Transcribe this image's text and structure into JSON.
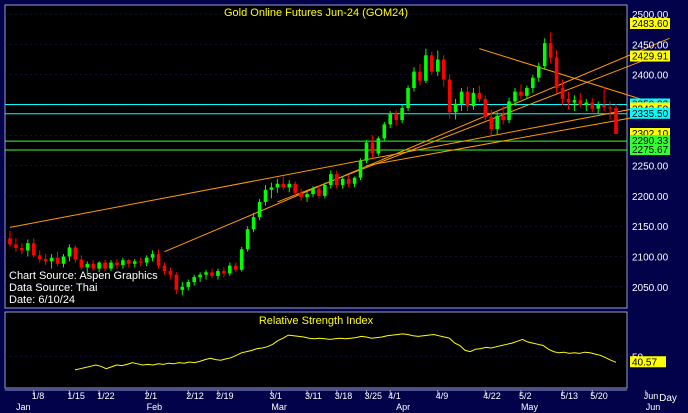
{
  "chart_data": [
    {
      "type": "candlestick",
      "title": "Gold Online Futures Jun-24 (GOM24)",
      "annotations": [
        "Chart Source: Aspen Graphics",
        "Data Source: Thai",
        "Date: 6/10/24"
      ],
      "ylim": [
        2020,
        2510
      ],
      "y_ticks": [
        2050,
        2100,
        2150,
        2200,
        2250,
        2300,
        2350,
        2400,
        2450,
        2500
      ],
      "y_tick_labels": [
        "2050.00",
        "2100.00",
        "2150.00",
        "2200.00",
        "2250.00",
        "2300.00",
        "2350.00",
        "2400.00",
        "2450.00",
        "2500.00"
      ],
      "price_labels": [
        {
          "value": 2483.6,
          "text": "2483.60",
          "color": "#ffff00"
        },
        {
          "value": 2429.91,
          "text": "2429.91",
          "color": "#ffff00"
        },
        {
          "value": 2350.83,
          "text": "2350.83",
          "color": "#00ffff"
        },
        {
          "value": 2344.32,
          "text": "2344.32",
          "color": "#ffff00"
        },
        {
          "value": 2342.5,
          "text": "2342.50",
          "color": "#ffff00"
        },
        {
          "value": 2335.5,
          "text": "2335.50",
          "color": "#00ffff"
        },
        {
          "value": 2302.1,
          "text": "2302.10",
          "color": "#ffff00"
        },
        {
          "value": 2290.33,
          "text": "2290.33",
          "color": "#33ff33"
        },
        {
          "value": 2275.67,
          "text": "2275.67",
          "color": "#33ff33"
        }
      ],
      "horizontal_lines": [
        {
          "value": 2350.83,
          "color": "#00ffff"
        },
        {
          "value": 2335.5,
          "color": "#00ffff"
        },
        {
          "value": 2290.33,
          "color": "#33ff33"
        },
        {
          "value": 2275.67,
          "color": "#33ff33"
        }
      ],
      "trend_lines": [
        {
          "from": [
            0,
            2148
          ],
          "to": [
            111,
            2355
          ],
          "color": "#ff9900"
        },
        {
          "from": [
            26,
            2108
          ],
          "to": [
            111,
            2460
          ],
          "color": "#ff9900"
        },
        {
          "from": [
            45,
            2190
          ],
          "to": [
            111,
            2440
          ],
          "color": "#ff9900"
        },
        {
          "from": [
            79,
            2443
          ],
          "to": [
            111,
            2345
          ],
          "color": "#ff9900"
        },
        {
          "from": [
            60,
            2250
          ],
          "to": [
            111,
            2340
          ],
          "color": "#ff9900"
        }
      ],
      "candles": [
        {
          "o": 2130,
          "h": 2142,
          "l": 2116,
          "c": 2120
        },
        {
          "o": 2120,
          "h": 2130,
          "l": 2108,
          "c": 2114
        },
        {
          "o": 2114,
          "h": 2122,
          "l": 2104,
          "c": 2110
        },
        {
          "o": 2110,
          "h": 2128,
          "l": 2100,
          "c": 2122
        },
        {
          "o": 2122,
          "h": 2130,
          "l": 2098,
          "c": 2102
        },
        {
          "o": 2102,
          "h": 2110,
          "l": 2090,
          "c": 2096
        },
        {
          "o": 2096,
          "h": 2104,
          "l": 2086,
          "c": 2092
        },
        {
          "o": 2092,
          "h": 2104,
          "l": 2080,
          "c": 2098
        },
        {
          "o": 2098,
          "h": 2108,
          "l": 2084,
          "c": 2088
        },
        {
          "o": 2088,
          "h": 2104,
          "l": 2082,
          "c": 2100
        },
        {
          "o": 2100,
          "h": 2120,
          "l": 2092,
          "c": 2115
        },
        {
          "o": 2115,
          "h": 2118,
          "l": 2090,
          "c": 2095
        },
        {
          "o": 2095,
          "h": 2102,
          "l": 2078,
          "c": 2082
        },
        {
          "o": 2082,
          "h": 2092,
          "l": 2072,
          "c": 2088
        },
        {
          "o": 2088,
          "h": 2094,
          "l": 2076,
          "c": 2080
        },
        {
          "o": 2080,
          "h": 2092,
          "l": 2074,
          "c": 2090
        },
        {
          "o": 2090,
          "h": 2095,
          "l": 2076,
          "c": 2080
        },
        {
          "o": 2080,
          "h": 2094,
          "l": 2076,
          "c": 2090
        },
        {
          "o": 2090,
          "h": 2096,
          "l": 2080,
          "c": 2086
        },
        {
          "o": 2086,
          "h": 2098,
          "l": 2080,
          "c": 2094
        },
        {
          "o": 2094,
          "h": 2096,
          "l": 2082,
          "c": 2088
        },
        {
          "o": 2088,
          "h": 2096,
          "l": 2082,
          "c": 2092
        },
        {
          "o": 2092,
          "h": 2098,
          "l": 2084,
          "c": 2090
        },
        {
          "o": 2090,
          "h": 2102,
          "l": 2084,
          "c": 2098
        },
        {
          "o": 2098,
          "h": 2110,
          "l": 2092,
          "c": 2104
        },
        {
          "o": 2104,
          "h": 2112,
          "l": 2080,
          "c": 2085
        },
        {
          "o": 2085,
          "h": 2090,
          "l": 2070,
          "c": 2076
        },
        {
          "o": 2076,
          "h": 2082,
          "l": 2062,
          "c": 2070
        },
        {
          "o": 2070,
          "h": 2074,
          "l": 2038,
          "c": 2045
        },
        {
          "o": 2045,
          "h": 2058,
          "l": 2036,
          "c": 2050
        },
        {
          "o": 2050,
          "h": 2062,
          "l": 2044,
          "c": 2058
        },
        {
          "o": 2058,
          "h": 2070,
          "l": 2052,
          "c": 2066
        },
        {
          "o": 2066,
          "h": 2074,
          "l": 2058,
          "c": 2070
        },
        {
          "o": 2070,
          "h": 2078,
          "l": 2062,
          "c": 2074
        },
        {
          "o": 2074,
          "h": 2080,
          "l": 2064,
          "c": 2068
        },
        {
          "o": 2068,
          "h": 2080,
          "l": 2062,
          "c": 2076
        },
        {
          "o": 2076,
          "h": 2082,
          "l": 2066,
          "c": 2072
        },
        {
          "o": 2072,
          "h": 2090,
          "l": 2068,
          "c": 2085
        },
        {
          "o": 2085,
          "h": 2090,
          "l": 2074,
          "c": 2078
        },
        {
          "o": 2078,
          "h": 2116,
          "l": 2075,
          "c": 2112
        },
        {
          "o": 2112,
          "h": 2150,
          "l": 2108,
          "c": 2145
        },
        {
          "o": 2145,
          "h": 2172,
          "l": 2140,
          "c": 2165
        },
        {
          "o": 2165,
          "h": 2195,
          "l": 2160,
          "c": 2190
        },
        {
          "o": 2190,
          "h": 2218,
          "l": 2184,
          "c": 2210
        },
        {
          "o": 2210,
          "h": 2222,
          "l": 2196,
          "c": 2214
        },
        {
          "o": 2214,
          "h": 2228,
          "l": 2205,
          "c": 2220
        },
        {
          "o": 2220,
          "h": 2232,
          "l": 2210,
          "c": 2214
        },
        {
          "o": 2214,
          "h": 2226,
          "l": 2206,
          "c": 2220
        },
        {
          "o": 2220,
          "h": 2224,
          "l": 2200,
          "c": 2205
        },
        {
          "o": 2205,
          "h": 2212,
          "l": 2192,
          "c": 2198
        },
        {
          "o": 2198,
          "h": 2208,
          "l": 2190,
          "c": 2203
        },
        {
          "o": 2203,
          "h": 2216,
          "l": 2198,
          "c": 2212
        },
        {
          "o": 2212,
          "h": 2218,
          "l": 2196,
          "c": 2200
        },
        {
          "o": 2200,
          "h": 2222,
          "l": 2196,
          "c": 2218
        },
        {
          "o": 2218,
          "h": 2242,
          "l": 2212,
          "c": 2236
        },
        {
          "o": 2236,
          "h": 2242,
          "l": 2212,
          "c": 2218
        },
        {
          "o": 2218,
          "h": 2232,
          "l": 2212,
          "c": 2228
        },
        {
          "o": 2228,
          "h": 2234,
          "l": 2214,
          "c": 2220
        },
        {
          "o": 2220,
          "h": 2232,
          "l": 2214,
          "c": 2230
        },
        {
          "o": 2230,
          "h": 2262,
          "l": 2226,
          "c": 2258
        },
        {
          "o": 2258,
          "h": 2292,
          "l": 2254,
          "c": 2288
        },
        {
          "o": 2288,
          "h": 2300,
          "l": 2262,
          "c": 2270
        },
        {
          "o": 2270,
          "h": 2298,
          "l": 2266,
          "c": 2295
        },
        {
          "o": 2295,
          "h": 2322,
          "l": 2290,
          "c": 2318
        },
        {
          "o": 2318,
          "h": 2340,
          "l": 2312,
          "c": 2335
        },
        {
          "o": 2335,
          "h": 2342,
          "l": 2316,
          "c": 2325
        },
        {
          "o": 2325,
          "h": 2350,
          "l": 2320,
          "c": 2345
        },
        {
          "o": 2345,
          "h": 2382,
          "l": 2340,
          "c": 2378
        },
        {
          "o": 2378,
          "h": 2412,
          "l": 2372,
          "c": 2405
        },
        {
          "o": 2405,
          "h": 2418,
          "l": 2382,
          "c": 2390
        },
        {
          "o": 2390,
          "h": 2443,
          "l": 2386,
          "c": 2432
        },
        {
          "o": 2432,
          "h": 2438,
          "l": 2400,
          "c": 2405
        },
        {
          "o": 2405,
          "h": 2440,
          "l": 2398,
          "c": 2425
        },
        {
          "o": 2425,
          "h": 2432,
          "l": 2380,
          "c": 2392
        },
        {
          "o": 2392,
          "h": 2400,
          "l": 2328,
          "c": 2338
        },
        {
          "o": 2338,
          "h": 2360,
          "l": 2326,
          "c": 2352
        },
        {
          "o": 2352,
          "h": 2378,
          "l": 2340,
          "c": 2372
        },
        {
          "o": 2372,
          "h": 2380,
          "l": 2340,
          "c": 2348
        },
        {
          "o": 2348,
          "h": 2378,
          "l": 2342,
          "c": 2370
        },
        {
          "o": 2370,
          "h": 2382,
          "l": 2355,
          "c": 2360
        },
        {
          "o": 2360,
          "h": 2366,
          "l": 2325,
          "c": 2330
        },
        {
          "o": 2330,
          "h": 2342,
          "l": 2300,
          "c": 2310
        },
        {
          "o": 2310,
          "h": 2338,
          "l": 2302,
          "c": 2332
        },
        {
          "o": 2332,
          "h": 2348,
          "l": 2318,
          "c": 2325
        },
        {
          "o": 2325,
          "h": 2362,
          "l": 2320,
          "c": 2356
        },
        {
          "o": 2356,
          "h": 2378,
          "l": 2348,
          "c": 2372
        },
        {
          "o": 2372,
          "h": 2384,
          "l": 2360,
          "c": 2365
        },
        {
          "o": 2365,
          "h": 2382,
          "l": 2360,
          "c": 2378
        },
        {
          "o": 2378,
          "h": 2400,
          "l": 2370,
          "c": 2395
        },
        {
          "o": 2395,
          "h": 2420,
          "l": 2388,
          "c": 2414
        },
        {
          "o": 2414,
          "h": 2460,
          "l": 2408,
          "c": 2452
        },
        {
          "o": 2452,
          "h": 2470,
          "l": 2418,
          "c": 2428
        },
        {
          "o": 2428,
          "h": 2440,
          "l": 2370,
          "c": 2378
        },
        {
          "o": 2378,
          "h": 2392,
          "l": 2350,
          "c": 2360
        },
        {
          "o": 2360,
          "h": 2372,
          "l": 2342,
          "c": 2354
        },
        {
          "o": 2354,
          "h": 2366,
          "l": 2340,
          "c": 2358
        },
        {
          "o": 2358,
          "h": 2370,
          "l": 2346,
          "c": 2350
        },
        {
          "o": 2350,
          "h": 2360,
          "l": 2340,
          "c": 2354
        },
        {
          "o": 2354,
          "h": 2362,
          "l": 2338,
          "c": 2344
        },
        {
          "o": 2344,
          "h": 2356,
          "l": 2336,
          "c": 2350
        },
        {
          "o": 2350,
          "h": 2380,
          "l": 2340,
          "c": 2346
        },
        {
          "o": 2346,
          "h": 2356,
          "l": 2326,
          "c": 2345
        },
        {
          "o": 2345,
          "h": 2352,
          "l": 2310,
          "c": 2302
        }
      ],
      "x_ticks": [
        {
          "index": 4,
          "label": "1/8"
        },
        {
          "index": 10,
          "label": "1/15"
        },
        {
          "index": 15,
          "label": "1/22"
        },
        {
          "index": 23,
          "label": "2/1"
        },
        {
          "index": 30,
          "label": "2/12"
        },
        {
          "index": 35,
          "label": "2/19"
        },
        {
          "index": 44,
          "label": "3/1"
        },
        {
          "index": 50,
          "label": "3/11"
        },
        {
          "index": 55,
          "label": "3/18"
        },
        {
          "index": 60,
          "label": "3/25"
        },
        {
          "index": 64,
          "label": "4/1"
        },
        {
          "index": 72,
          "label": "4/9"
        },
        {
          "index": 80,
          "label": "4/22"
        },
        {
          "index": 86,
          "label": "5/2"
        },
        {
          "index": 93,
          "label": "5/13"
        },
        {
          "index": 98,
          "label": "5/20"
        },
        {
          "index": 107,
          "label": "Jun"
        }
      ],
      "month_labels": [
        {
          "index": 1,
          "label": "Jan"
        },
        {
          "index": 23,
          "label": "Feb"
        },
        {
          "index": 44,
          "label": "Mar"
        },
        {
          "index": 65,
          "label": "Apr"
        },
        {
          "index": 86,
          "label": "May"
        },
        {
          "index": 107,
          "label": "Jun"
        }
      ],
      "period_label": "Day",
      "up_color": "#00ff00",
      "down_color": "#ff0000"
    },
    {
      "type": "line",
      "title": "Relative Strength Index",
      "ylim": [
        0,
        100
      ],
      "y_ticks": [
        50
      ],
      "y_tick_labels": [
        "50"
      ],
      "last_value_label": "40.57",
      "color": "#ffff00",
      "series": [
        {
          "values": [
            28,
            30,
            32,
            34,
            36,
            34,
            30,
            33,
            36,
            35,
            37,
            40,
            38,
            36,
            37,
            36,
            38,
            37,
            39,
            38,
            40,
            39,
            41,
            40,
            42,
            45,
            47,
            45,
            44,
            46,
            48,
            52,
            56,
            58,
            60,
            63,
            64,
            66,
            70,
            76,
            80,
            85,
            84,
            83,
            82,
            80,
            79,
            80,
            79,
            78,
            79,
            80,
            79,
            80,
            81,
            83,
            82,
            80,
            81,
            82,
            84,
            85,
            86,
            87,
            86,
            84,
            83,
            84,
            85,
            86,
            84,
            82,
            80,
            72,
            68,
            60,
            58,
            62,
            63,
            65,
            64,
            66,
            68,
            70,
            72,
            75,
            78,
            74,
            72,
            70,
            68,
            62,
            58,
            56,
            57,
            55,
            56,
            55,
            57,
            56,
            54,
            52,
            48,
            44,
            40.57
          ]
        }
      ]
    }
  ]
}
